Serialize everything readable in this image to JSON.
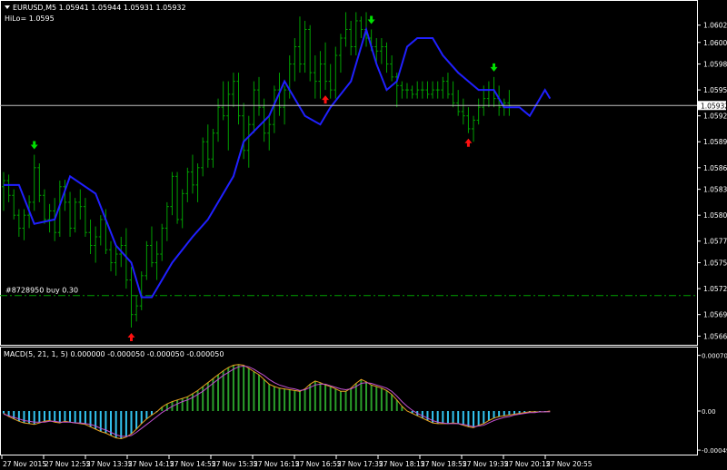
{
  "header": {
    "symbol_line": "EURUSD,M5  1.05941 1.05944 1.05931 1.05932",
    "indicator_line": "HiLo= 1.0595"
  },
  "order_label": "#8728950 buy 0.30",
  "current_price_label": "1.05932",
  "macd_header": "MACD(5, 21, 1, 5) 0.000000 -0.000050 -0.000050 -0.000050",
  "colors": {
    "background": "#000000",
    "frame": "#ffffff",
    "bars": "#00a000",
    "hilo_line": "#2020ff",
    "order_line": "#00a000",
    "up_arrow": "#ff1010",
    "down_arrow": "#00e000",
    "macd_positive": "#2a9e2a",
    "macd_negative": "#33c4f0",
    "macd_line": "#e8a020",
    "signal_line": "#c050d0"
  },
  "chart_data": {
    "type": "bar",
    "symbol": "EURUSD",
    "timeframe": "M5",
    "price_ticks": [
      1.06025,
      1.06005,
      1.0598,
      1.0595,
      1.0592,
      1.0589,
      1.0586,
      1.05835,
      1.05805,
      1.05775,
      1.0575,
      1.0572,
      1.0569,
      1.05665
    ],
    "price_range": [
      1.05655,
      1.06052
    ],
    "current_price": 1.05932,
    "order_price": 1.05712,
    "time_labels": [
      "27 Nov 2015",
      "27 Nov 12:55",
      "27 Nov 13:35",
      "27 Nov 14:15",
      "27 Nov 14:55",
      "27 Nov 15:35",
      "27 Nov 16:15",
      "27 Nov 16:55",
      "27 Nov 17:35",
      "27 Nov 18:15",
      "27 Nov 18:55",
      "27 Nov 19:35",
      "27 Nov 20:15",
      "27 Nov 20:55"
    ],
    "bars": [
      [
        1.05838,
        1.05855,
        1.0581,
        1.05845
      ],
      [
        1.05845,
        1.05852,
        1.0582,
        1.05828
      ],
      [
        1.05828,
        1.05835,
        1.058,
        1.05805
      ],
      [
        1.05805,
        1.05812,
        1.0578,
        1.0579
      ],
      [
        1.0579,
        1.05812,
        1.05776,
        1.05805
      ],
      [
        1.05805,
        1.05828,
        1.0579,
        1.0582
      ],
      [
        1.0582,
        1.05875,
        1.0581,
        1.0586
      ],
      [
        1.0586,
        1.05865,
        1.0582,
        1.05828
      ],
      [
        1.05828,
        1.05835,
        1.05795,
        1.058
      ],
      [
        1.058,
        1.05818,
        1.05785,
        1.0581
      ],
      [
        1.0581,
        1.05825,
        1.05775,
        1.05785
      ],
      [
        1.05785,
        1.05845,
        1.0578,
        1.05838
      ],
      [
        1.05838,
        1.05846,
        1.0581,
        1.0582
      ],
      [
        1.0582,
        1.05832,
        1.0578,
        1.0579
      ],
      [
        1.0579,
        1.05825,
        1.05785,
        1.0582
      ],
      [
        1.0582,
        1.05835,
        1.058,
        1.05815
      ],
      [
        1.05815,
        1.05825,
        1.0578,
        1.05785
      ],
      [
        1.05785,
        1.058,
        1.0576,
        1.0577
      ],
      [
        1.0577,
        1.05792,
        1.0575,
        1.0578
      ],
      [
        1.0578,
        1.05805,
        1.0577,
        1.058
      ],
      [
        1.058,
        1.05812,
        1.0576,
        1.05765
      ],
      [
        1.05765,
        1.05775,
        1.0574,
        1.0575
      ],
      [
        1.0575,
        1.0577,
        1.05735,
        1.0576
      ],
      [
        1.0576,
        1.0578,
        1.05745,
        1.0577
      ],
      [
        1.0577,
        1.0579,
        1.0572,
        1.0573
      ],
      [
        1.0573,
        1.05745,
        1.05675,
        1.0569
      ],
      [
        1.0569,
        1.05712,
        1.05682,
        1.057
      ],
      [
        1.057,
        1.0574,
        1.05695,
        1.05735
      ],
      [
        1.05735,
        1.05775,
        1.0573,
        1.0577
      ],
      [
        1.0577,
        1.05792,
        1.05745,
        1.0575
      ],
      [
        1.0575,
        1.05775,
        1.0573,
        1.0576
      ],
      [
        1.0576,
        1.05795,
        1.05752,
        1.0579
      ],
      [
        1.0579,
        1.0582,
        1.05775,
        1.05815
      ],
      [
        1.05815,
        1.05855,
        1.05805,
        1.0585
      ],
      [
        1.0585,
        1.05855,
        1.05795,
        1.058
      ],
      [
        1.058,
        1.05835,
        1.0579,
        1.0583
      ],
      [
        1.0583,
        1.0586,
        1.0582,
        1.05855
      ],
      [
        1.05855,
        1.05875,
        1.0583,
        1.0584
      ],
      [
        1.0584,
        1.05865,
        1.0582,
        1.0586
      ],
      [
        1.0586,
        1.05895,
        1.0585,
        1.0589
      ],
      [
        1.0589,
        1.0591,
        1.0586,
        1.0587
      ],
      [
        1.0587,
        1.05905,
        1.0586,
        1.059
      ],
      [
        1.059,
        1.0594,
        1.0589,
        1.0593
      ],
      [
        1.0593,
        1.0596,
        1.05915,
        1.0592
      ],
      [
        1.0592,
        1.0596,
        1.0588,
        1.05945
      ],
      [
        1.05945,
        1.0597,
        1.0593,
        1.0596
      ],
      [
        1.0596,
        1.0597,
        1.0591,
        1.0592
      ],
      [
        1.0592,
        1.05935,
        1.0587,
        1.0588
      ],
      [
        1.0588,
        1.0592,
        1.0586,
        1.0591
      ],
      [
        1.0591,
        1.0596,
        1.059,
        1.0595
      ],
      [
        1.0595,
        1.05965,
        1.0592,
        1.0593
      ],
      [
        1.0593,
        1.0594,
        1.0589,
        1.059
      ],
      [
        1.059,
        1.0592,
        1.0588,
        1.0591
      ],
      [
        1.0591,
        1.05955,
        1.059,
        1.0595
      ],
      [
        1.0595,
        1.0597,
        1.0592,
        1.0593
      ],
      [
        1.0593,
        1.05955,
        1.0591,
        1.0595
      ],
      [
        1.0595,
        1.0599,
        1.0594,
        1.0598
      ],
      [
        1.0598,
        1.0601,
        1.0596,
        1.06
      ],
      [
        1.06,
        1.06035,
        1.0597,
        1.0598
      ],
      [
        1.0598,
        1.0603,
        1.0597,
        1.0602
      ],
      [
        1.0602,
        1.06025,
        1.0596,
        1.0597
      ],
      [
        1.0597,
        1.0599,
        1.0594,
        1.0596
      ],
      [
        1.0596,
        1.05995,
        1.0594,
        1.0598
      ],
      [
        1.0598,
        1.06005,
        1.0595,
        1.0596
      ],
      [
        1.0596,
        1.0598,
        1.0594,
        1.0595
      ],
      [
        1.0595,
        1.06,
        1.0594,
        1.0599
      ],
      [
        1.0599,
        1.06015,
        1.0597,
        1.0601
      ],
      [
        1.0601,
        1.0604,
        1.06,
        1.0602
      ],
      [
        1.0602,
        1.0603,
        1.0599,
        1.06
      ],
      [
        1.06,
        1.0604,
        1.0599,
        1.0603
      ],
      [
        1.0603,
        1.06035,
        1.0601,
        1.0602
      ],
      [
        1.0602,
        1.0604,
        1.06,
        1.0601
      ],
      [
        1.0601,
        1.0602,
        1.05995,
        1.06
      ],
      [
        1.06,
        1.0601,
        1.0598,
        1.05995
      ],
      [
        1.05995,
        1.0601,
        1.0598,
        1.06
      ],
      [
        1.06,
        1.06005,
        1.0597,
        1.0598
      ],
      [
        1.0598,
        1.0599,
        1.0596,
        1.05965
      ],
      [
        1.05965,
        1.0597,
        1.0593,
        1.05955
      ],
      [
        1.05955,
        1.0596,
        1.0594,
        1.0595
      ],
      [
        1.0595,
        1.05958,
        1.0594,
        1.0595
      ],
      [
        1.0595,
        1.05955,
        1.0594,
        1.05945
      ],
      [
        1.05945,
        1.0596,
        1.0594,
        1.0595
      ],
      [
        1.0595,
        1.0596,
        1.0594,
        1.0595
      ],
      [
        1.0595,
        1.0596,
        1.0594,
        1.05945
      ],
      [
        1.05945,
        1.0596,
        1.0594,
        1.0595
      ],
      [
        1.0595,
        1.0596,
        1.0594,
        1.0595
      ],
      [
        1.0595,
        1.05965,
        1.0594,
        1.0596
      ],
      [
        1.0596,
        1.0597,
        1.0594,
        1.05945
      ],
      [
        1.05945,
        1.0596,
        1.0593,
        1.05935
      ],
      [
        1.05935,
        1.0595,
        1.0592,
        1.05925
      ],
      [
        1.05925,
        1.0594,
        1.0591,
        1.0592
      ],
      [
        1.0592,
        1.0593,
        1.059,
        1.05905
      ],
      [
        1.05905,
        1.0592,
        1.0589,
        1.05915
      ],
      [
        1.05915,
        1.0594,
        1.0591,
        1.0593
      ],
      [
        1.0593,
        1.05955,
        1.0592,
        1.0594
      ],
      [
        1.0594,
        1.0596,
        1.0593,
        1.0595
      ],
      [
        1.0595,
        1.05965,
        1.0593,
        1.0594
      ],
      [
        1.0594,
        1.05955,
        1.0592,
        1.0593
      ],
      [
        1.0593,
        1.0594,
        1.0592,
        1.05935
      ],
      [
        1.05935,
        1.0595,
        1.0592,
        1.05932
      ]
    ],
    "hilo_line": [
      [
        0,
        1.0584
      ],
      [
        3,
        1.0584
      ],
      [
        6,
        1.05795
      ],
      [
        10,
        1.058
      ],
      [
        13,
        1.0585
      ],
      [
        18,
        1.0583
      ],
      [
        22,
        1.0577
      ],
      [
        25,
        1.0575
      ],
      [
        27,
        1.0571
      ],
      [
        29,
        1.0571
      ],
      [
        33,
        1.0575
      ],
      [
        37,
        1.0578
      ],
      [
        40,
        1.058
      ],
      [
        45,
        1.0585
      ],
      [
        47,
        1.0589
      ],
      [
        52,
        1.0592
      ],
      [
        55,
        1.0596
      ],
      [
        57,
        1.0594
      ],
      [
        59,
        1.0592
      ],
      [
        62,
        1.0591
      ],
      [
        64,
        1.0593
      ],
      [
        68,
        1.0596
      ],
      [
        71,
        1.0602
      ],
      [
        73,
        1.0598
      ],
      [
        75,
        1.0595
      ],
      [
        77,
        1.0596
      ],
      [
        79,
        1.06
      ],
      [
        81,
        1.0601
      ],
      [
        84,
        1.0601
      ],
      [
        86,
        1.0599
      ],
      [
        89,
        1.0597
      ],
      [
        91,
        1.0596
      ],
      [
        93,
        1.0595
      ],
      [
        96,
        1.0595
      ],
      [
        98,
        1.0593
      ],
      [
        101,
        1.0593
      ],
      [
        103,
        1.0592
      ],
      [
        106,
        1.0595
      ],
      [
        107,
        1.0594
      ]
    ],
    "signals": [
      {
        "type": "sell",
        "bar": 6
      },
      {
        "type": "buy",
        "bar": 25
      },
      {
        "type": "buy",
        "bar": 63
      },
      {
        "type": "sell",
        "bar": 72
      },
      {
        "type": "buy",
        "bar": 91
      },
      {
        "type": "sell",
        "bar": 96
      }
    ],
    "macd_ticks": [
      0.000705,
      0.0,
      -0.000495
    ],
    "macd_tick_labels": [
      "0.000705",
      "0.00",
      "-0.000495"
    ],
    "macd_range": [
      -0.00054,
      0.00077
    ],
    "macd_histogram": [
      -3e-05,
      -7e-05,
      -0.0001,
      -0.00013,
      -0.00015,
      -0.00016,
      -0.00017,
      -0.00015,
      -0.00013,
      -0.00012,
      -0.00014,
      -0.00015,
      -0.00013,
      -0.00014,
      -0.00015,
      -0.00016,
      -0.00017,
      -0.0002,
      -0.00023,
      -0.00026,
      -0.00028,
      -0.00031,
      -0.00034,
      -0.00035,
      -0.00033,
      -0.00029,
      -0.00023,
      -0.00016,
      -0.0001,
      -5e-05,
      -1e-05,
      5e-05,
      9e-05,
      0.00012,
      0.00014,
      0.00016,
      0.00018,
      0.00022,
      0.00026,
      0.00031,
      0.00036,
      0.00041,
      0.00046,
      0.00051,
      0.00055,
      0.00058,
      0.00059,
      0.00058,
      0.00054,
      0.0005,
      0.00046,
      0.0004,
      0.00034,
      0.00031,
      0.00029,
      0.00028,
      0.00027,
      0.00026,
      0.00025,
      0.00028,
      0.00034,
      0.00038,
      0.00036,
      0.00033,
      0.00031,
      0.00028,
      0.00025,
      0.00025,
      0.00029,
      0.00035,
      0.0004,
      0.00037,
      0.00033,
      0.00031,
      0.00029,
      0.00026,
      0.00021,
      0.00014,
      6e-05,
      0.0,
      -3e-05,
      -6e-05,
      -9e-05,
      -0.00012,
      -0.00015,
      -0.00016,
      -0.00016,
      -0.00016,
      -0.00015,
      -0.00016,
      -0.00018,
      -0.0002,
      -0.00021,
      -0.00018,
      -0.00016,
      -0.00012,
      -9e-05,
      -7e-05,
      -6e-05,
      -5e-05,
      -4e-05,
      -3e-05,
      -2e-05,
      -1e-05,
      -1e-05,
      -1e-05,
      -1e-05,
      0.0
    ],
    "signal_line": [
      -4e-05,
      -6e-05,
      -8e-05,
      -0.0001,
      -0.00012,
      -0.00013,
      -0.00014,
      -0.00014,
      -0.00014,
      -0.00013,
      -0.00013,
      -0.00014,
      -0.00014,
      -0.00014,
      -0.00015,
      -0.00015,
      -0.00016,
      -0.00017,
      -0.00019,
      -0.00022,
      -0.00024,
      -0.00027,
      -0.0003,
      -0.00032,
      -0.00032,
      -0.00031,
      -0.00027,
      -0.00022,
      -0.00017,
      -0.00012,
      -7e-05,
      -2e-05,
      2e-05,
      6e-05,
      9e-05,
      0.00012,
      0.00014,
      0.00017,
      0.00021,
      0.00025,
      0.0003,
      0.00035,
      0.0004,
      0.00045,
      0.00049,
      0.00053,
      0.00056,
      0.00057,
      0.00056,
      0.00053,
      0.00049,
      0.00045,
      0.0004,
      0.00036,
      0.00033,
      0.00031,
      0.00029,
      0.00028,
      0.00026,
      0.00027,
      0.0003,
      0.00033,
      0.00034,
      0.00034,
      0.00032,
      0.0003,
      0.00028,
      0.00027,
      0.00028,
      0.00031,
      0.00035,
      0.00036,
      0.00035,
      0.00033,
      0.00031,
      0.00029,
      0.00025,
      0.00019,
      0.00012,
      6e-05,
      1e-05,
      -3e-05,
      -6e-05,
      -9e-05,
      -0.00012,
      -0.00014,
      -0.00015,
      -0.00016,
      -0.00016,
      -0.00016,
      -0.00017,
      -0.00018,
      -0.0002,
      -0.00019,
      -0.00018,
      -0.00015,
      -0.00012,
      -0.0001,
      -8e-05,
      -7e-05,
      -5e-05,
      -4e-05,
      -3e-05,
      -2e-05,
      -2e-05,
      -1e-05,
      -1e-05,
      -1e-05
    ]
  }
}
